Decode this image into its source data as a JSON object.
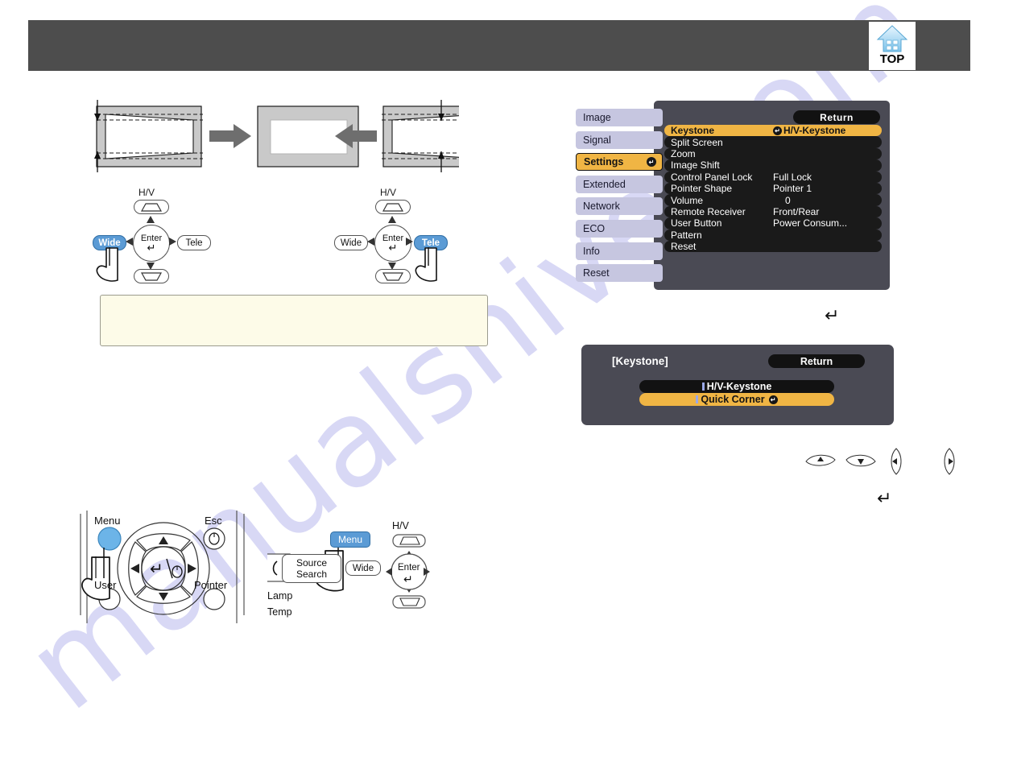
{
  "page": {
    "watermark": "manualshive.com",
    "header": {
      "title": ""
    }
  },
  "top_nav": {
    "label": "TOP",
    "icon": "home-top-icon"
  },
  "keystone_diagram": {
    "name": "keystone-correction-diagram",
    "left_shape": "trapezoid-left",
    "center_shape": "corrected-rectangle",
    "right_shape": "trapezoid-right",
    "arrow_left": "arrow-right-icon",
    "arrow_right": "arrow-left-icon"
  },
  "zoom_controls": {
    "wide_group": {
      "hv_label": "H/V",
      "up_key": "keystone-up-icon",
      "down_key": "keystone-down-icon",
      "left_label": "Wide",
      "right_label": "Tele",
      "enter_label": "Enter",
      "selected": "Wide",
      "hand": "pointing-hand-icon"
    },
    "tele_group": {
      "hv_label": "H/V",
      "up_key": "keystone-up-icon",
      "down_key": "keystone-down-icon",
      "left_label": "Wide",
      "right_label": "Tele",
      "enter_label": "Enter",
      "selected": "Tele",
      "hand": "pointing-hand-icon"
    }
  },
  "note_box": {
    "text": ""
  },
  "osd_main_menu": {
    "return_label": "Return",
    "sidebar": [
      {
        "label": "Image",
        "active": false
      },
      {
        "label": "Signal",
        "active": false
      },
      {
        "label": "Settings",
        "active": true
      },
      {
        "label": "Extended",
        "active": false
      },
      {
        "label": "Network",
        "active": false
      },
      {
        "label": "ECO",
        "active": false
      },
      {
        "label": "Info",
        "active": false
      },
      {
        "label": "Reset",
        "active": false
      }
    ],
    "rows": [
      {
        "label": "Keystone",
        "value": "H/V-Keystone",
        "highlighted": true,
        "enter_icon": true
      },
      {
        "label": "Split Screen",
        "value": "",
        "highlighted": false,
        "enter_icon": false
      },
      {
        "label": "Zoom",
        "value": "",
        "highlighted": false,
        "enter_icon": false
      },
      {
        "label": "Image Shift",
        "value": "",
        "highlighted": false,
        "enter_icon": false
      },
      {
        "label": "Control Panel Lock",
        "value": "Full Lock",
        "highlighted": false,
        "enter_icon": false
      },
      {
        "label": "Pointer Shape",
        "value": "Pointer 1",
        "highlighted": false,
        "enter_icon": false
      },
      {
        "label": "Volume",
        "value": "0",
        "highlighted": false,
        "enter_icon": false
      },
      {
        "label": "Remote Receiver",
        "value": "Front/Rear",
        "highlighted": false,
        "enter_icon": false
      },
      {
        "label": "User Button",
        "value": "Power Consum...",
        "highlighted": false,
        "enter_icon": false
      },
      {
        "label": "Pattern",
        "value": "",
        "highlighted": false,
        "enter_icon": false
      },
      {
        "label": "Reset",
        "value": "",
        "highlighted": false,
        "enter_icon": false
      }
    ]
  },
  "osd_keystone_submenu": {
    "title": "[Keystone]",
    "return_label": "Return",
    "options": [
      {
        "label": "H/V-Keystone",
        "selected": false,
        "enter_icon": false
      },
      {
        "label": "Quick Corner",
        "selected": true,
        "enter_icon": true
      }
    ]
  },
  "enter_markers": {
    "glyph": "↵",
    "first": "enter-step-marker-1",
    "second": "enter-step-marker-2"
  },
  "arrow_keys": [
    {
      "name": "arrow-up-key",
      "glyph": "▲"
    },
    {
      "name": "arrow-down-key",
      "glyph": "▼"
    },
    {
      "name": "arrow-left-key",
      "glyph": "◀"
    },
    {
      "name": "arrow-right-key",
      "glyph": "▶"
    }
  ],
  "remote_control": {
    "menu_label": "Menu",
    "esc_label": "Esc",
    "user_label": "User",
    "pointer_label": "Pointer",
    "selected_button": "Menu",
    "dpad": {
      "up": "▲",
      "down": "▼",
      "left": "◀",
      "right": "▶",
      "center": "enter-mouse-icon"
    },
    "hand": "pointing-hand-icon"
  },
  "projector_panel": {
    "menu_label": "Menu",
    "source_search_label_line1": "Source",
    "source_search_label_line2": "Search",
    "wide_label": "Wide",
    "enter_label": "Enter",
    "hv_label": "H/V",
    "lamp_label": "Lamp",
    "temp_label": "Temp",
    "power_icon": "power-icon",
    "selected_button": "Menu",
    "hand": "pointing-hand-icon"
  },
  "colors": {
    "header_bar": "#4d4d4d",
    "osd_panel": "#4a4a54",
    "osd_sidebar_item": "#c6c6e0",
    "osd_highlight": "#f0b544",
    "osd_row": "#1a1a1a",
    "key_selected": "#5b9bd5",
    "note_box": "#fdfbe8",
    "watermark": "#ccccf2"
  }
}
